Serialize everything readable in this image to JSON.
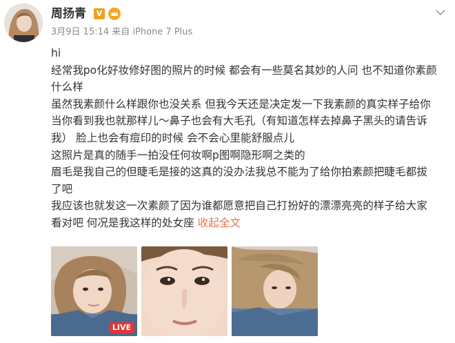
{
  "post": {
    "username": "周扬青",
    "verified_badge": "V",
    "meta_date": "3月9日 15:14",
    "meta_source": "来自 iPhone 7 Plus",
    "lines": [
      "hi",
      "经常我po化好妆修好图的照片的时候 都会有一些莫名其妙的人问 也不知道你素颜",
      "什么样",
      "虽然我素颜什么样跟你也没关系 但我今天还是决定发一下我素颜的真实样子给你",
      "当你看到我也就那样儿～鼻子也会有大毛孔（有知道怎样去掉鼻子黑头的请告诉",
      "我） 脸上也会有痘印的时候 会不会心里能舒服点儿",
      "这照片是真的随手一拍没任何妆啊p图啊隐形啊之类的",
      "眉毛是我自己的但睫毛是接的这真的没办法我总不能为了给你拍素颜把睫毛都拔",
      "了吧",
      "我应该也就发这一次素颜了因为谁都愿意把自己打扮好的漂漂亮亮的样子给大家",
      "看对吧 何况是我这样的处女座"
    ],
    "expand_label": "收起全文",
    "live_label": "LIVE"
  },
  "icons": {
    "verified": "verified-v-badge",
    "member": "member-crown-icon",
    "menu": "chevron-down-icon"
  },
  "colors": {
    "link": "#eb7350",
    "verified": "#f0a020",
    "live": "#e53535",
    "meta": "#8a8a8a"
  }
}
